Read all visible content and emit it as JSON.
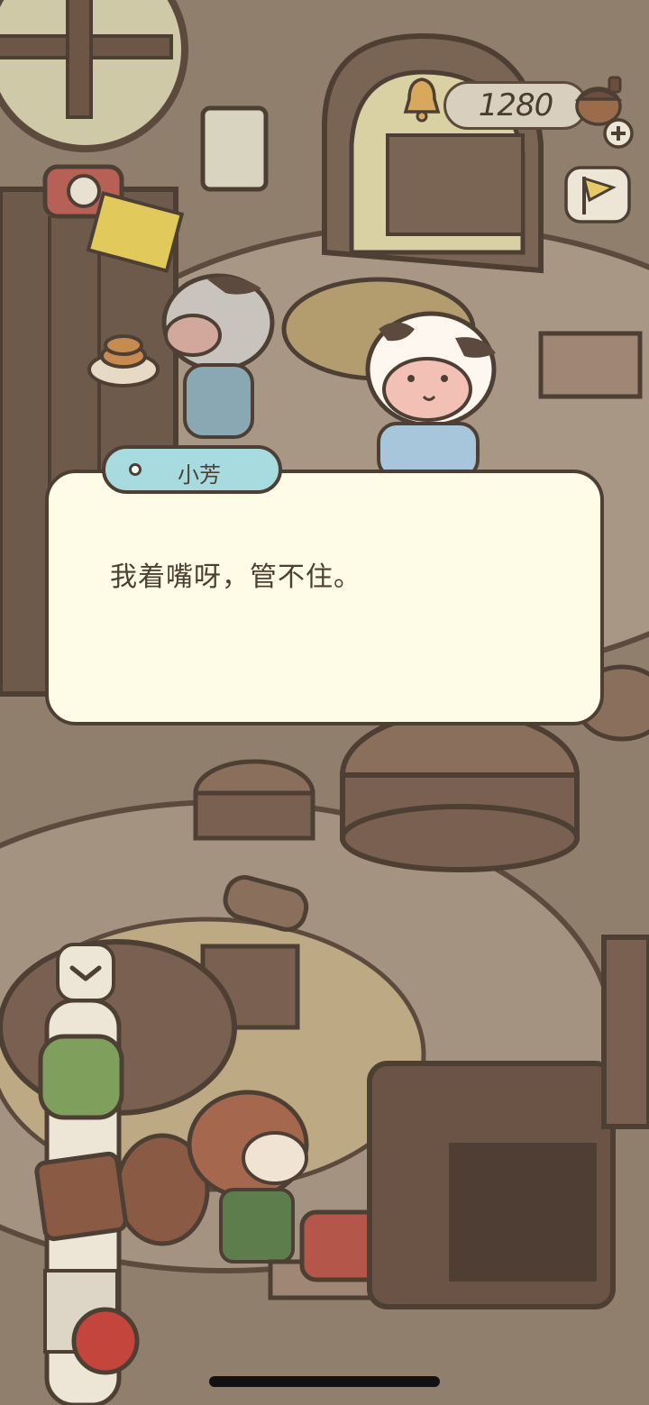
{
  "hud": {
    "coins": "1280",
    "coin_icon": "acorn-coin-icon",
    "add_icon": "plus-icon",
    "bell_icon": "bell-icon",
    "flag_icon": "flag-icon"
  },
  "dialog": {
    "speaker": "小芳",
    "text": "我着嘴呀，管不住。"
  },
  "side_panel": {
    "collapse_icon": "chevron-down-icon"
  },
  "colors": {
    "dialog_bg": "#fefbe7",
    "tag_bg": "#a8dbe0",
    "outline": "#4d3f34"
  }
}
